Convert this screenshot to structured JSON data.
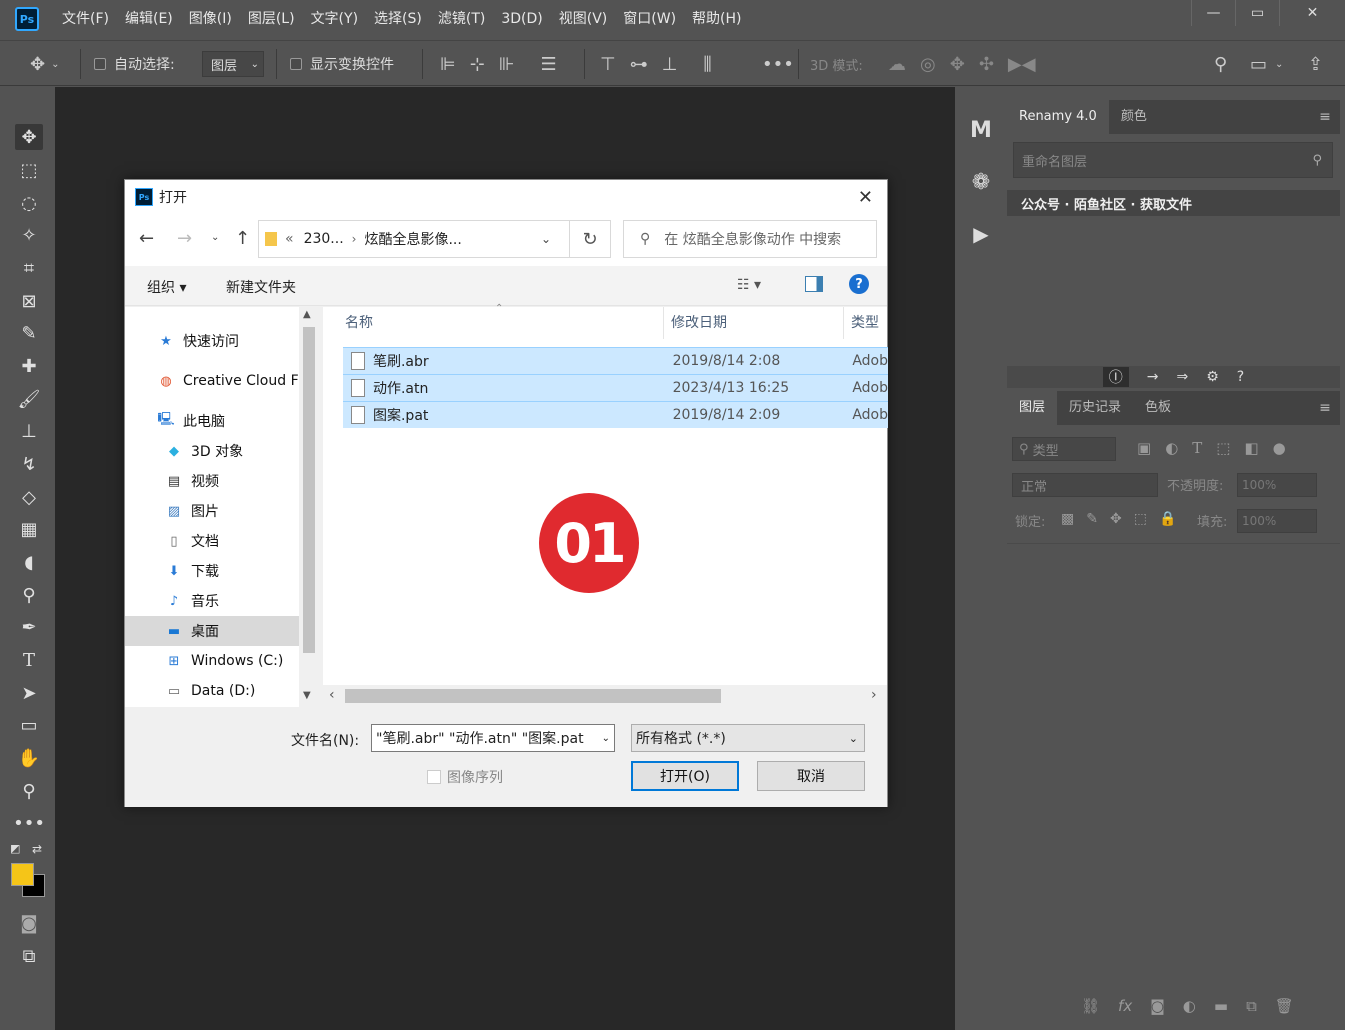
{
  "app": {
    "logo": "Ps",
    "menus": [
      "文件(F)",
      "编辑(E)",
      "图像(I)",
      "图层(L)",
      "文字(Y)",
      "选择(S)",
      "滤镜(T)",
      "3D(D)",
      "视图(V)",
      "窗口(W)",
      "帮助(H)"
    ]
  },
  "options": {
    "auto_select_label": "自动选择:",
    "auto_select_value": "图层",
    "show_transform_label": "显示变换控件",
    "mode_3d_label": "3D 模式:"
  },
  "right_panel_top": {
    "tabs": [
      "Renamy 4.0",
      "颜色"
    ],
    "rename_placeholder": "重命名图层",
    "banner": "公众号 · 陌鱼社区 · 获取文件"
  },
  "layers_panel": {
    "tabs": [
      "图层",
      "历史记录",
      "色板"
    ],
    "filter_label": "类型",
    "blend_mode": "正常",
    "opacity_label": "不透明度:",
    "opacity_value": "100%",
    "lock_label": "锁定:",
    "fill_label": "填充:",
    "fill_value": "100%"
  },
  "strip": {
    "m_label": "M"
  },
  "dialog": {
    "title": "打开",
    "path_prefix": "«",
    "path_parent": "230...",
    "path_current": "炫酷全息影像...",
    "search_placeholder": "在 炫酷全息影像动作 中搜索",
    "organize": "组织 ▾",
    "new_folder": "新建文件夹",
    "nav_items": [
      {
        "label": "快速访问",
        "icon": "star-icon"
      },
      {
        "label": "Creative Cloud F",
        "icon": "creative-cloud-icon"
      },
      {
        "label": "此电脑",
        "icon": "computer-icon"
      },
      {
        "label": "3D 对象",
        "icon": "cube-icon"
      },
      {
        "label": "视频",
        "icon": "video-icon"
      },
      {
        "label": "图片",
        "icon": "picture-icon"
      },
      {
        "label": "文档",
        "icon": "document-icon"
      },
      {
        "label": "下载",
        "icon": "download-icon"
      },
      {
        "label": "音乐",
        "icon": "music-icon"
      },
      {
        "label": "桌面",
        "icon": "desktop-icon"
      },
      {
        "label": "Windows (C:)",
        "icon": "drive-icon"
      },
      {
        "label": "Data (D:)",
        "icon": "drive-icon"
      }
    ],
    "columns": [
      "名称",
      "修改日期",
      "类型"
    ],
    "files": [
      {
        "name": "笔刷.abr",
        "date": "2019/8/14 2:08",
        "type": "Adob"
      },
      {
        "name": "动作.atn",
        "date": "2023/4/13 16:25",
        "type": "Adob"
      },
      {
        "name": "图案.pat",
        "date": "2019/8/14 2:09",
        "type": "Adob"
      }
    ],
    "filename_label": "文件名(N):",
    "filename_value": "\"笔刷.abr\" \"动作.atn\" \"图案.pat",
    "filter_value": "所有格式 (*.*)",
    "image_sequence": "图像序列",
    "open_button": "打开(O)",
    "cancel_button": "取消"
  },
  "badge": "01",
  "colors": {
    "foreground": "#f5c518",
    "background": "#000000",
    "badge": "#e02a2f"
  }
}
